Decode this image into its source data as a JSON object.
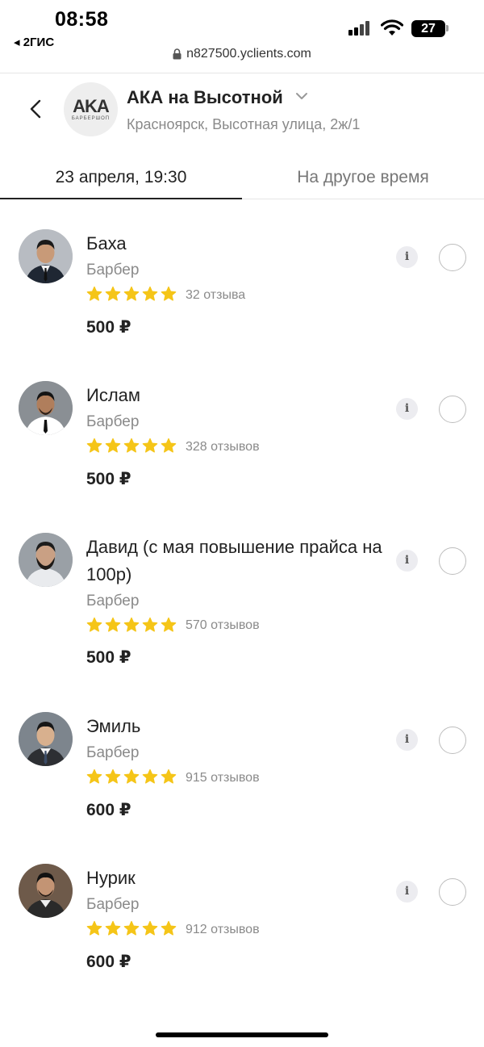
{
  "status_bar": {
    "time": "08:58",
    "back_app": "◂ 2ГИС",
    "battery": "27"
  },
  "browser": {
    "url": "n827500.yclients.com"
  },
  "header": {
    "logo_text": "AKA",
    "logo_sub": "БАРБЕРШОП",
    "salon_name": "АКА на Высотной",
    "address": "Красноярск, Высотная улица, 2ж/1"
  },
  "tabs": [
    {
      "label": "23 апреля, 19:30",
      "active": true
    },
    {
      "label": "На другое время",
      "active": false
    }
  ],
  "colors": {
    "star": "#f5c518",
    "text": "#222222",
    "muted": "#8a8a8a"
  },
  "staff": [
    {
      "name": "Баха",
      "role": "Барбер",
      "rating": 5,
      "reviews": "32 отзыва",
      "price": "500 ₽"
    },
    {
      "name": "Ислам",
      "role": "Барбер",
      "rating": 5,
      "reviews": "328 отзывов",
      "price": "500 ₽"
    },
    {
      "name": "Давид (с мая повышение прайса на 100р)",
      "role": "Барбер",
      "rating": 5,
      "reviews": "570 отзывов",
      "price": "500 ₽"
    },
    {
      "name": "Эмиль",
      "role": "Барбер",
      "rating": 5,
      "reviews": "915 отзывов",
      "price": "600 ₽"
    },
    {
      "name": "Нурик",
      "role": "Барбер",
      "rating": 5,
      "reviews": "912 отзывов",
      "price": "600 ₽"
    }
  ],
  "icons": {
    "info": "i"
  }
}
